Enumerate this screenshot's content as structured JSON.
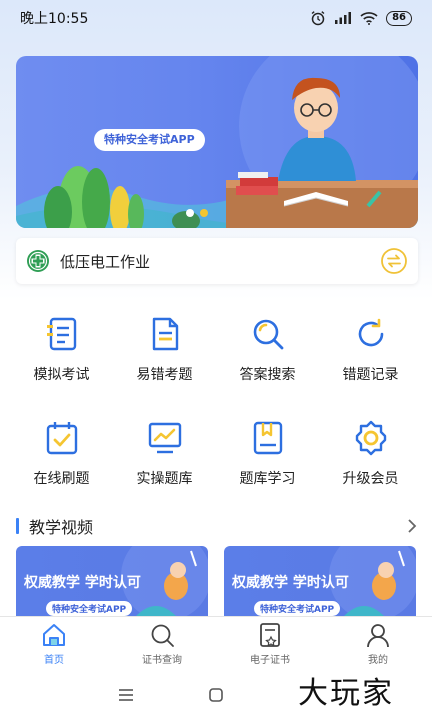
{
  "status_bar": {
    "time": "晚上10:55",
    "battery": "86"
  },
  "banner": {
    "tag_text": "特种安全考试APP",
    "dots_total": 2,
    "dots_active_index": 1
  },
  "cert_selector": {
    "title": "低压电工作业"
  },
  "grid": [
    {
      "label": "模拟考试",
      "icon": "exam-list-icon"
    },
    {
      "label": "易错考题",
      "icon": "document-icon"
    },
    {
      "label": "答案搜索",
      "icon": "search-icon"
    },
    {
      "label": "错题记录",
      "icon": "refresh-icon"
    },
    {
      "label": "在线刷题",
      "icon": "calendar-check-icon"
    },
    {
      "label": "实操题库",
      "icon": "chart-screen-icon"
    },
    {
      "label": "题库学习",
      "icon": "bookmark-book-icon"
    },
    {
      "label": "升级会员",
      "icon": "gear-badge-icon"
    }
  ],
  "section": {
    "title": "教学视频"
  },
  "videos": [
    {
      "title": "权威教学 学时认可",
      "tag": "特种安全考试APP"
    },
    {
      "title": "权威教学 学时认可",
      "tag": "特种安全考试APP"
    }
  ],
  "tab_bar": [
    {
      "label": "首页",
      "icon": "home-icon",
      "active": true
    },
    {
      "label": "证书查询",
      "icon": "search-icon",
      "active": false
    },
    {
      "label": "电子证书",
      "icon": "certificate-icon",
      "active": false
    },
    {
      "label": "我的",
      "icon": "user-icon",
      "active": false
    }
  ],
  "watermark": "大玩家",
  "colors": {
    "accent": "#3b82f6",
    "banner": "#5f80ec",
    "icon_yellow": "#f5c531"
  }
}
